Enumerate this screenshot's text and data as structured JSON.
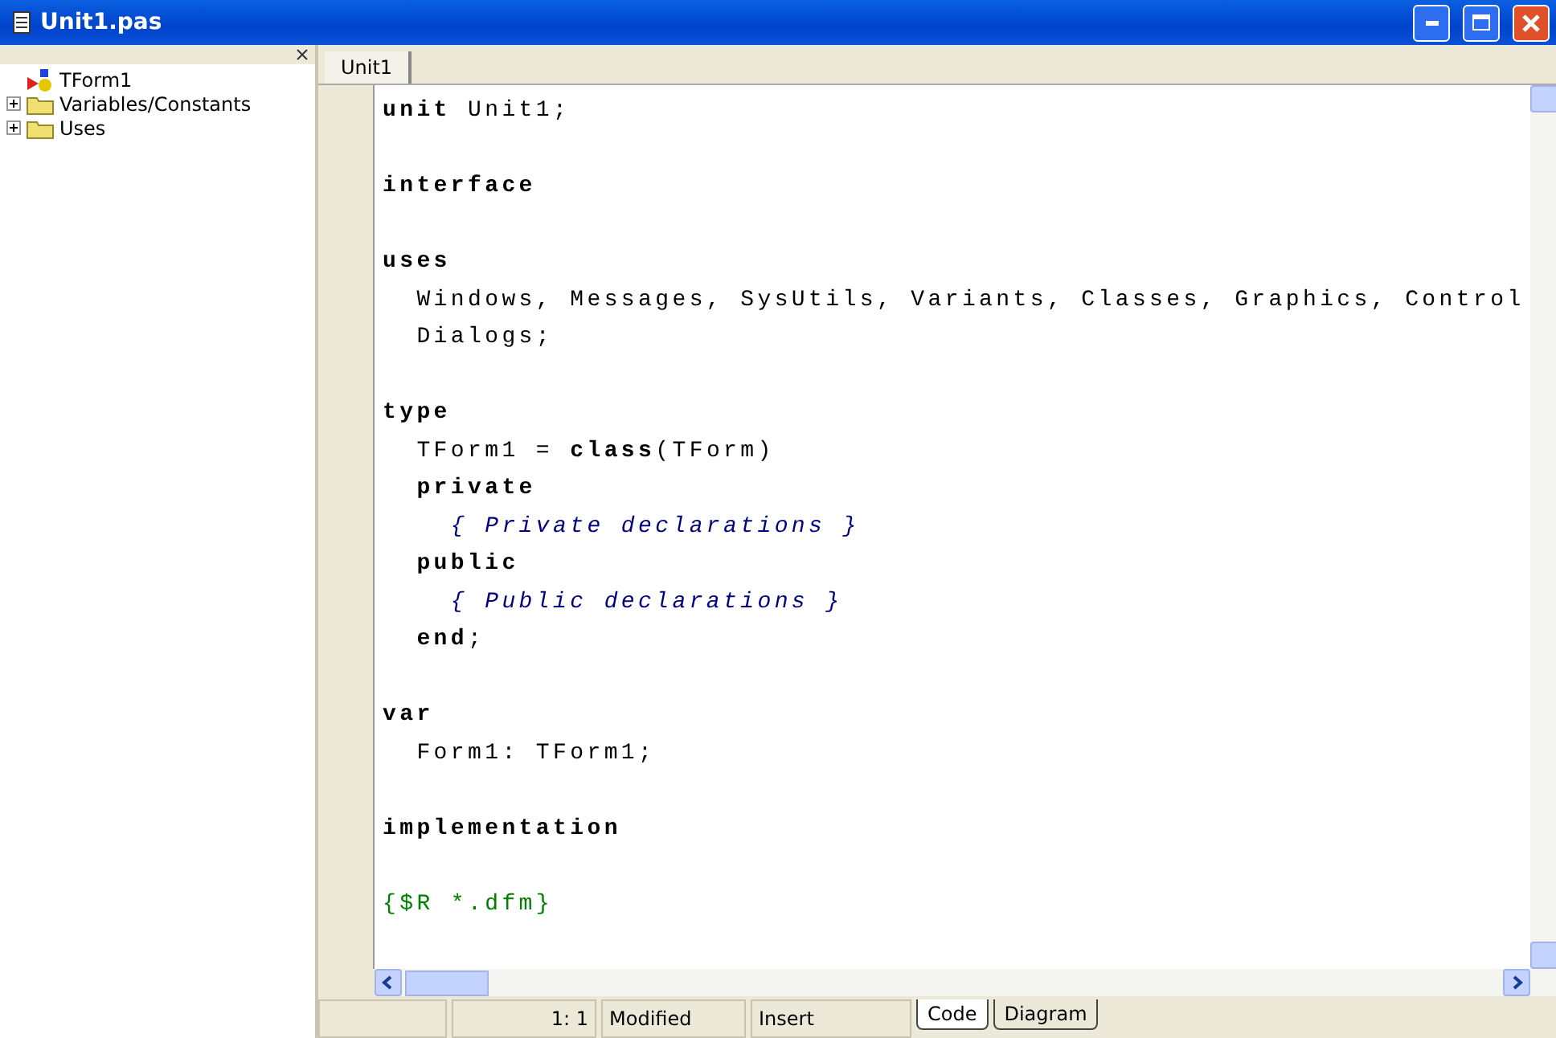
{
  "window": {
    "title": "Unit1.pas"
  },
  "explorer": {
    "items": [
      {
        "label": "TForm1",
        "kind": "form"
      },
      {
        "label": "Variables/Constants",
        "kind": "folder",
        "expanded": false
      },
      {
        "label": "Uses",
        "kind": "folder",
        "expanded": false
      }
    ]
  },
  "tabs": [
    {
      "label": "Unit1",
      "selected": true
    }
  ],
  "code": {
    "lines": [
      {
        "gap_before": false,
        "segments": [
          {
            "kind": "keyword",
            "text": "unit"
          },
          {
            "kind": "plain",
            "text": " Unit1;"
          }
        ]
      },
      {
        "gap_before": true,
        "segments": [
          {
            "kind": "keyword",
            "text": "interface"
          }
        ]
      },
      {
        "gap_before": true,
        "segments": [
          {
            "kind": "keyword",
            "text": "uses"
          }
        ]
      },
      {
        "gap_before": false,
        "segments": [
          {
            "kind": "plain",
            "text": "  Windows, Messages, SysUtils, Variants, Classes, Graphics, Control"
          }
        ]
      },
      {
        "gap_before": false,
        "segments": [
          {
            "kind": "plain",
            "text": "  Dialogs;"
          }
        ]
      },
      {
        "gap_before": true,
        "segments": [
          {
            "kind": "keyword",
            "text": "type"
          }
        ]
      },
      {
        "gap_before": false,
        "segments": [
          {
            "kind": "plain",
            "text": "  TForm1 = "
          },
          {
            "kind": "keyword",
            "text": "class"
          },
          {
            "kind": "plain",
            "text": "(TForm)"
          }
        ]
      },
      {
        "gap_before": false,
        "segments": [
          {
            "kind": "keyword",
            "text": "  private"
          }
        ]
      },
      {
        "gap_before": false,
        "segments": [
          {
            "kind": "comment",
            "text": "    { Private declarations }"
          }
        ]
      },
      {
        "gap_before": false,
        "segments": [
          {
            "kind": "keyword",
            "text": "  public"
          }
        ]
      },
      {
        "gap_before": false,
        "segments": [
          {
            "kind": "comment",
            "text": "    { Public declarations }"
          }
        ]
      },
      {
        "gap_before": false,
        "segments": [
          {
            "kind": "keyword",
            "text": "  end"
          },
          {
            "kind": "plain",
            "text": ";"
          }
        ]
      },
      {
        "gap_before": true,
        "segments": [
          {
            "kind": "keyword",
            "text": "var"
          }
        ]
      },
      {
        "gap_before": false,
        "segments": [
          {
            "kind": "plain",
            "text": "  Form1: TForm1;"
          }
        ]
      },
      {
        "gap_before": true,
        "segments": [
          {
            "kind": "keyword",
            "text": "implementation"
          }
        ]
      },
      {
        "gap_before": true,
        "segments": [
          {
            "kind": "directive",
            "text": "{$R *.dfm}"
          }
        ]
      }
    ]
  },
  "status_bar": {
    "position": "1:  1",
    "modified": "Modified",
    "mode": "Insert",
    "tabs": [
      {
        "label": "Code",
        "selected": true
      },
      {
        "label": "Diagram",
        "selected": false
      }
    ]
  }
}
